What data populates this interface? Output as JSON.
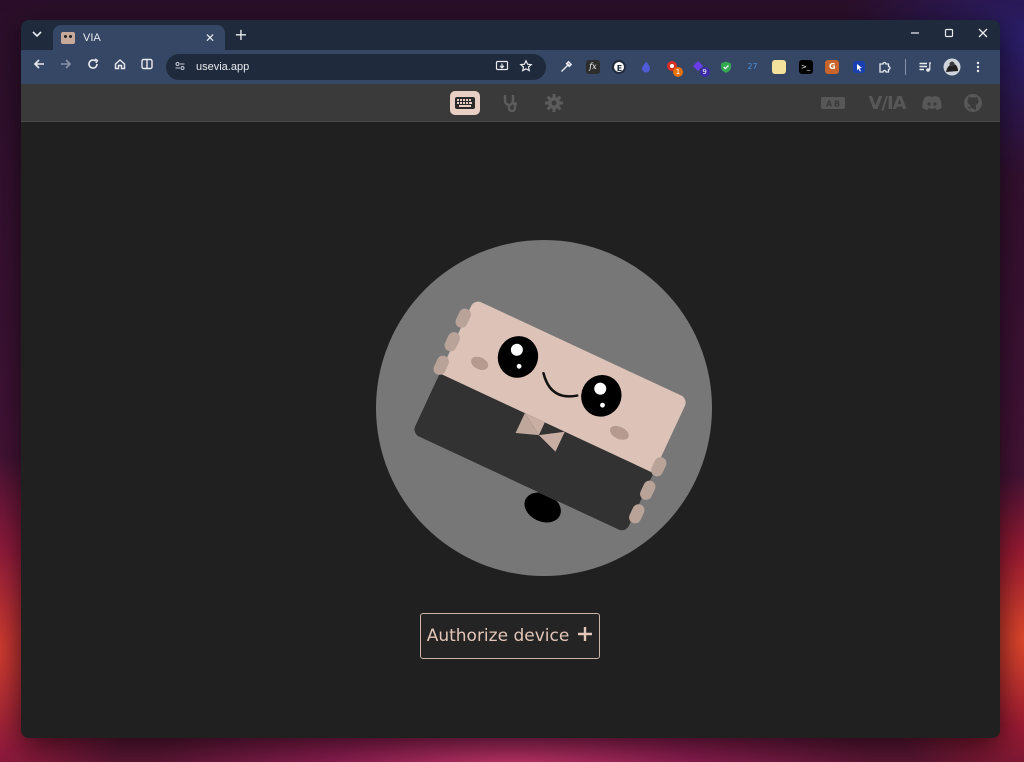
{
  "browser": {
    "tab": {
      "title": "VIA",
      "favicon": "via-keyboard-icon"
    },
    "url": "usevia.app",
    "icons": {
      "tab_list": "chevron-down-icon",
      "new_tab": "plus-icon",
      "minimize": "minimize-icon",
      "maximize": "maximize-icon",
      "close": "close-icon",
      "back": "back-arrow-icon",
      "forward": "forward-arrow-icon",
      "reload": "reload-icon",
      "home": "home-icon",
      "split": "split-view-icon",
      "install": "install-app-icon",
      "bookmark": "star-icon"
    },
    "extensions": [
      {
        "name": "eyedropper-icon",
        "color": "#e8eaed",
        "label": ""
      },
      {
        "name": "fx-icon",
        "color": "#1f2a3d",
        "label": "fx"
      },
      {
        "name": "e-extension-icon",
        "color": "#ffffff",
        "label": "E"
      },
      {
        "name": "flame-icon",
        "color": "#4f5bd5",
        "label": ""
      },
      {
        "name": "badge-red-icon",
        "color": "#d93025",
        "label": "1"
      },
      {
        "name": "badge-purple-icon",
        "color": "#6a3de8",
        "label": "9"
      },
      {
        "name": "shield-icon",
        "color": "#34a853",
        "label": ""
      },
      {
        "name": "ublock-icon",
        "color": "#2b6cb0",
        "label": "27"
      },
      {
        "name": "note-icon",
        "color": "#f2e29b",
        "label": ""
      },
      {
        "name": "terminal-icon",
        "color": "#000000",
        "label": ">_"
      },
      {
        "name": "grammarly-icon",
        "color": "#c9652b",
        "label": "G"
      },
      {
        "name": "cursor-icon",
        "color": "#1a3fb0",
        "label": ""
      },
      {
        "name": "puzzle-icon",
        "color": "#e8eaed",
        "label": ""
      }
    ],
    "toolbar_end": [
      "media-queue-icon",
      "profile-avatar",
      "more-vert-icon"
    ]
  },
  "app": {
    "nav": [
      "keyboard-icon",
      "stethoscope-icon",
      "gear-icon"
    ],
    "header_right": [
      "keyboard-layout-icon",
      "via-logo",
      "discord-icon",
      "github-icon"
    ],
    "logo_text": "V/IA",
    "authorize_label": "Authorize device",
    "accent": "#e9cec3"
  }
}
